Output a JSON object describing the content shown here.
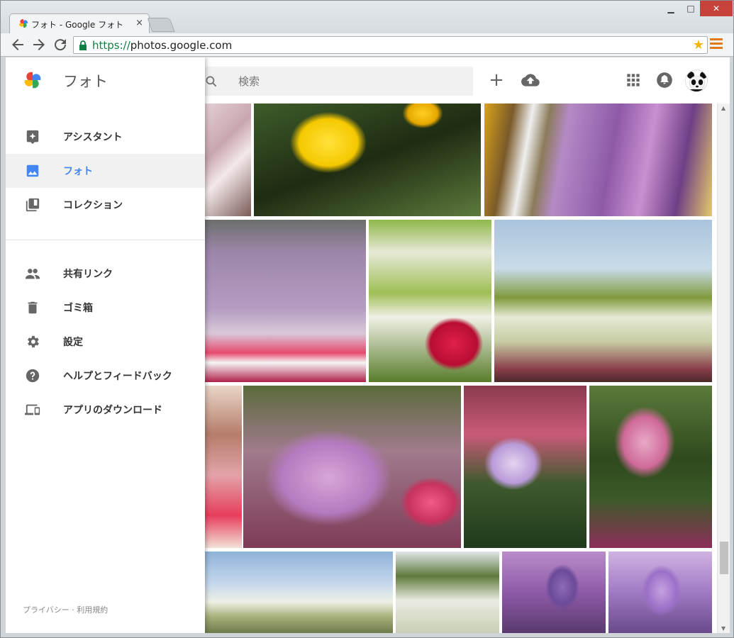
{
  "browser": {
    "tab_title": "フォト - Google フォト",
    "tab_close": "×",
    "url_scheme": "https://",
    "url_host": "photos.google.com",
    "window_controls": {
      "minimize": "▁",
      "maximize": "□",
      "close": "✕"
    }
  },
  "appbar": {
    "search_placeholder": "検索",
    "icons": [
      "search-icon",
      "add-icon",
      "upload-icon",
      "apps-icon",
      "notifications-icon",
      "avatar"
    ]
  },
  "drawer": {
    "title": "フォト",
    "primary_items": [
      {
        "label": "アシスタント",
        "icon": "assistant-icon"
      },
      {
        "label": "フォト",
        "icon": "photo-icon",
        "active": true
      },
      {
        "label": "コレクション",
        "icon": "collections-icon"
      }
    ],
    "secondary_items": [
      {
        "label": "共有リンク",
        "icon": "people-icon"
      },
      {
        "label": "ゴミ箱",
        "icon": "trash-icon"
      },
      {
        "label": "設定",
        "icon": "gear-icon"
      },
      {
        "label": "ヘルプとフィードバック",
        "icon": "help-icon"
      },
      {
        "label": "アプリのダウンロード",
        "icon": "devices-icon"
      }
    ],
    "footer": {
      "privacy": "プライバシー",
      "separator": "·",
      "terms": "利用規約"
    }
  },
  "colors": {
    "accent": "#4285f4",
    "active_bg": "#f1f1f1",
    "url_secure": "#0b8043"
  }
}
